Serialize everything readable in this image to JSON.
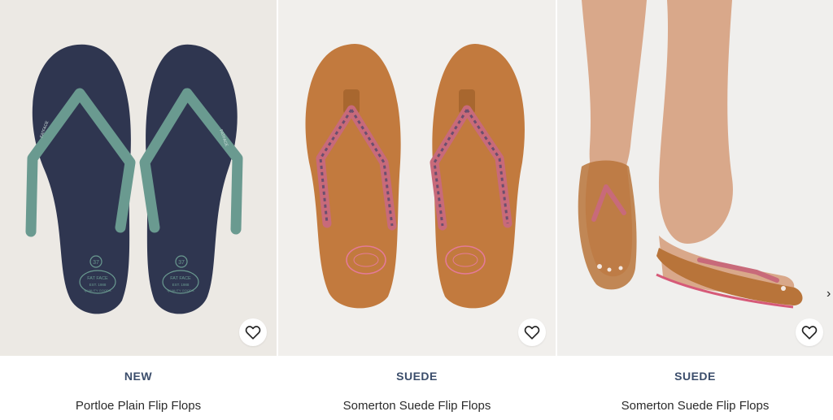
{
  "products": [
    {
      "badge": "NEW",
      "name": "Portloe Plain Flip Flops",
      "wishlist_icon": "heart-outline-icon",
      "image": "navy-flip-flops-green-straps",
      "sole_stamp_size": "37",
      "sole_logo": "FAT FACE",
      "sole_logo_est": "EST. 1988",
      "sole_logo_sub": "QUALITY GOODS",
      "strap_logo": "FATFACE",
      "colors": {
        "sole": "#2f3650",
        "strap": "#6a9a90",
        "bg": "#ece9e4"
      }
    },
    {
      "badge": "SUEDE",
      "name": "Somerton Suede Flip Flops",
      "wishlist_icon": "heart-outline-icon",
      "image": "tan-suede-flip-flops-embroidered-straps",
      "colors": {
        "sole": "#c27a3e",
        "strap": "#c86a7a",
        "bg": "#f1efec"
      }
    },
    {
      "badge": "SUEDE",
      "name": "Somerton Suede Flip Flops",
      "wishlist_icon": "heart-outline-icon",
      "image": "model-wearing-tan-suede-flip-flops",
      "colors": {
        "sole": "#b8743a",
        "strap": "#c86a7a",
        "bg": "#f0efed",
        "skin": "#d9a88a"
      }
    }
  ],
  "carousel": {
    "next_icon": "chevron-right-icon",
    "next_glyph": "›"
  },
  "colors": {
    "badge_text": "#3b4d6b",
    "name_text": "#2b2b2b"
  }
}
